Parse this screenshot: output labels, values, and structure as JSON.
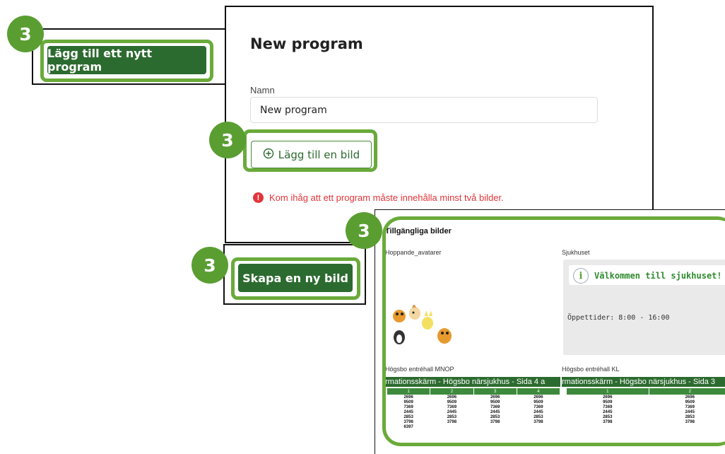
{
  "step_number": "3",
  "top_left": {
    "button_label": "Lägg till ett nytt program"
  },
  "program_form": {
    "title": "New program",
    "name_label": "Namn",
    "name_value": "New program",
    "add_image_label": "Lägg till en bild",
    "warning_text": "Kom ihåg att ett program måste innehålla minst två bilder."
  },
  "create_image": {
    "button_label": "Skapa en ny bild"
  },
  "available": {
    "title": "Tillgängliga bilder",
    "items": [
      {
        "label": "Hoppande_avatarer"
      },
      {
        "label": "Sjukhuset",
        "headline": "Välkommen till sjukhuset!",
        "body": "Öppettider: 8:00 - 16:00"
      },
      {
        "label": "Högsbo entréhall MNOP",
        "banner": "rmationsskärm - Högsbo närsjukhus - Sida 4 a"
      },
      {
        "label": "Högsbo entréhall KL",
        "banner": "rmationsskärm - Högsbo närsjukhus - Sida 3"
      }
    ],
    "table_left": {
      "headers": [
        "1",
        "2",
        "3",
        "4"
      ],
      "rows": [
        [
          "2696",
          "2696",
          "2696",
          "2696"
        ],
        [
          "9509",
          "9509",
          "9509",
          "9509"
        ],
        [
          "7369",
          "7369",
          "7369",
          "7369"
        ],
        [
          "2445",
          "2445",
          "2445",
          "2445"
        ],
        [
          "2853",
          "2853",
          "2853",
          "2853"
        ],
        [
          "3798",
          "3798",
          "3798",
          "3798"
        ],
        [
          "6397",
          "",
          "",
          ""
        ]
      ]
    },
    "table_right": {
      "headers": [
        "1",
        "2"
      ],
      "rows": [
        [
          "2696",
          "2696"
        ],
        [
          "9509",
          "9509"
        ],
        [
          "7369",
          "7369"
        ],
        [
          "2445",
          "2445"
        ],
        [
          "2853",
          "2853"
        ],
        [
          "3798",
          "3798"
        ]
      ]
    }
  },
  "colors": {
    "brand_green": "#2c6b2f",
    "highlight_green": "#6aaa3a",
    "warning_red": "#e0353a"
  }
}
